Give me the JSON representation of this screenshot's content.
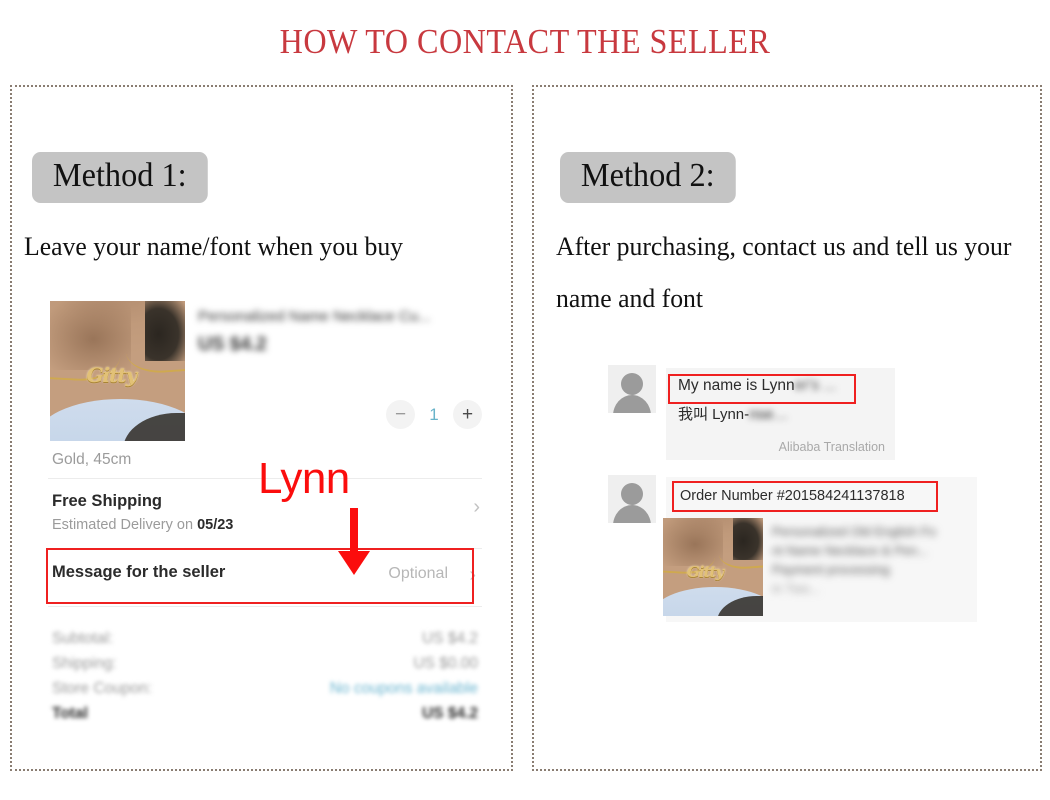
{
  "page": {
    "title": "HOW TO CONTACT THE SELLER",
    "title_color": "#c8393f"
  },
  "methods": [
    {
      "badge": "Method 1:",
      "description": "Leave your name/font when you buy"
    },
    {
      "badge": "Method 2:",
      "description": "After purchasing, contact us and tell us your name and font"
    }
  ],
  "order_card": {
    "product_title": "Personalized Name Necklace Cu...",
    "product_price": "US $4.2",
    "necklace_name": "Gitty",
    "quantity": {
      "decrement": "−",
      "value": "1",
      "increment": "+"
    },
    "variant": "Gold, 45cm",
    "shipping": {
      "title": "Free Shipping",
      "subtitle_prefix": "Estimated Delivery on ",
      "subtitle_date": "05/23",
      "chevron": "›"
    },
    "message_row": {
      "title": "Message for the seller",
      "value": "Optional",
      "chevron": "›"
    },
    "totals": [
      {
        "label": "Subtotal:",
        "value": "US $4.2",
        "style": "plain"
      },
      {
        "label": "Shipping:",
        "value": "US $0.00",
        "style": "plain"
      },
      {
        "label": "Store Coupon:",
        "value": "No coupons available",
        "style": "coupon"
      },
      {
        "label": "Total",
        "value": "US $4.2",
        "style": "total"
      }
    ]
  },
  "annotation": {
    "label": "Lynn",
    "color": "#fb0d0d"
  },
  "chat": {
    "message_1": {
      "english": "My name is Lynn",
      "english_blurred_tail": "er's ...",
      "chinese": "我叫  Lynn-",
      "chinese_blurred_tail": "nse…",
      "translation_note": "Alibaba Translation"
    },
    "message_2": {
      "order_number": "Order Number #201584241137818",
      "necklace_name": "Gitty",
      "product_line_1": "Personalized Old English Fo",
      "product_line_2": "nt Name Necklace & Pen...",
      "product_line_3": "Payment processing",
      "product_line_4": "in Two..."
    }
  }
}
